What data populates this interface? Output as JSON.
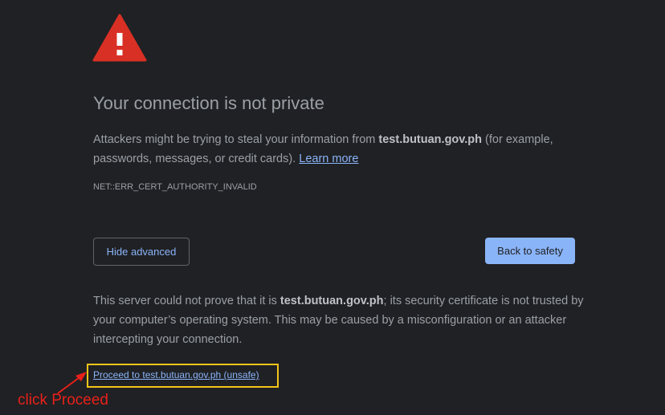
{
  "icon": "warning-triangle-icon",
  "colors": {
    "background": "#202124",
    "text": "#9aa0a6",
    "link": "#8ab4f8",
    "warning_red": "#d93025",
    "primary_button": "#8ab4f8",
    "highlight": "#f5c518",
    "annotation": "#e8201a"
  },
  "title": "Your connection is not private",
  "intro": {
    "before": "Attackers might be trying to steal your information from ",
    "host": "test.butuan.gov.ph",
    "after": " (for example, passwords, messages, or credit cards). ",
    "learn_more": "Learn more"
  },
  "error_code": "NET::ERR_CERT_AUTHORITY_INVALID",
  "buttons": {
    "hide_advanced": "Hide advanced",
    "back_to_safety": "Back to safety"
  },
  "details": {
    "before": "This server could not prove that it is ",
    "host": "test.butuan.gov.ph",
    "after": "; its security certificate is not trusted by your computer’s operating system. This may be caused by a misconfiguration or an attacker intercepting your connection."
  },
  "proceed_link": "Proceed to test.butuan.gov.ph (unsafe)",
  "annotation": "click Proceed"
}
